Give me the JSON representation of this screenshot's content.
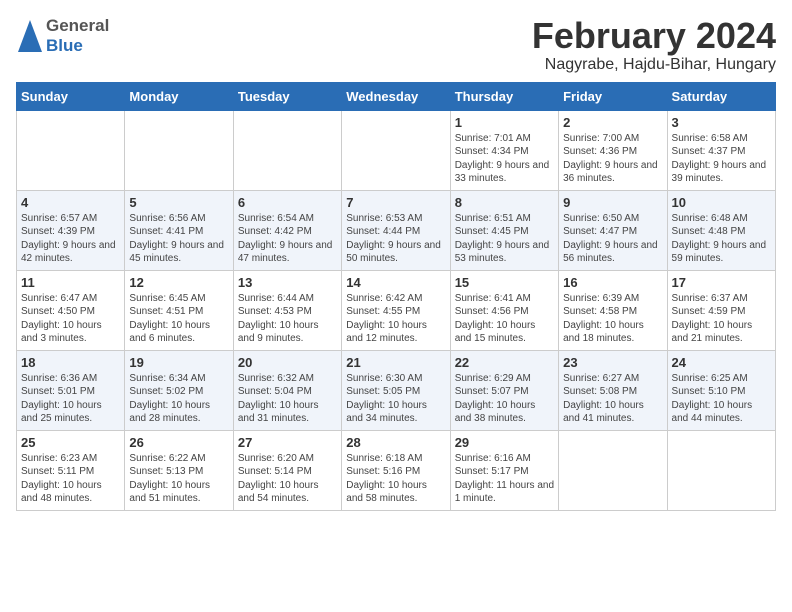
{
  "header": {
    "logo_general": "General",
    "logo_blue": "Blue",
    "title": "February 2024",
    "subtitle": "Nagyrabe, Hajdu-Bihar, Hungary"
  },
  "calendar": {
    "days_of_week": [
      "Sunday",
      "Monday",
      "Tuesday",
      "Wednesday",
      "Thursday",
      "Friday",
      "Saturday"
    ],
    "weeks": [
      [
        {
          "day": "",
          "sunrise": "",
          "sunset": "",
          "daylight": ""
        },
        {
          "day": "",
          "sunrise": "",
          "sunset": "",
          "daylight": ""
        },
        {
          "day": "",
          "sunrise": "",
          "sunset": "",
          "daylight": ""
        },
        {
          "day": "",
          "sunrise": "",
          "sunset": "",
          "daylight": ""
        },
        {
          "day": "1",
          "sunrise": "Sunrise: 7:01 AM",
          "sunset": "Sunset: 4:34 PM",
          "daylight": "Daylight: 9 hours and 33 minutes."
        },
        {
          "day": "2",
          "sunrise": "Sunrise: 7:00 AM",
          "sunset": "Sunset: 4:36 PM",
          "daylight": "Daylight: 9 hours and 36 minutes."
        },
        {
          "day": "3",
          "sunrise": "Sunrise: 6:58 AM",
          "sunset": "Sunset: 4:37 PM",
          "daylight": "Daylight: 9 hours and 39 minutes."
        }
      ],
      [
        {
          "day": "4",
          "sunrise": "Sunrise: 6:57 AM",
          "sunset": "Sunset: 4:39 PM",
          "daylight": "Daylight: 9 hours and 42 minutes."
        },
        {
          "day": "5",
          "sunrise": "Sunrise: 6:56 AM",
          "sunset": "Sunset: 4:41 PM",
          "daylight": "Daylight: 9 hours and 45 minutes."
        },
        {
          "day": "6",
          "sunrise": "Sunrise: 6:54 AM",
          "sunset": "Sunset: 4:42 PM",
          "daylight": "Daylight: 9 hours and 47 minutes."
        },
        {
          "day": "7",
          "sunrise": "Sunrise: 6:53 AM",
          "sunset": "Sunset: 4:44 PM",
          "daylight": "Daylight: 9 hours and 50 minutes."
        },
        {
          "day": "8",
          "sunrise": "Sunrise: 6:51 AM",
          "sunset": "Sunset: 4:45 PM",
          "daylight": "Daylight: 9 hours and 53 minutes."
        },
        {
          "day": "9",
          "sunrise": "Sunrise: 6:50 AM",
          "sunset": "Sunset: 4:47 PM",
          "daylight": "Daylight: 9 hours and 56 minutes."
        },
        {
          "day": "10",
          "sunrise": "Sunrise: 6:48 AM",
          "sunset": "Sunset: 4:48 PM",
          "daylight": "Daylight: 9 hours and 59 minutes."
        }
      ],
      [
        {
          "day": "11",
          "sunrise": "Sunrise: 6:47 AM",
          "sunset": "Sunset: 4:50 PM",
          "daylight": "Daylight: 10 hours and 3 minutes."
        },
        {
          "day": "12",
          "sunrise": "Sunrise: 6:45 AM",
          "sunset": "Sunset: 4:51 PM",
          "daylight": "Daylight: 10 hours and 6 minutes."
        },
        {
          "day": "13",
          "sunrise": "Sunrise: 6:44 AM",
          "sunset": "Sunset: 4:53 PM",
          "daylight": "Daylight: 10 hours and 9 minutes."
        },
        {
          "day": "14",
          "sunrise": "Sunrise: 6:42 AM",
          "sunset": "Sunset: 4:55 PM",
          "daylight": "Daylight: 10 hours and 12 minutes."
        },
        {
          "day": "15",
          "sunrise": "Sunrise: 6:41 AM",
          "sunset": "Sunset: 4:56 PM",
          "daylight": "Daylight: 10 hours and 15 minutes."
        },
        {
          "day": "16",
          "sunrise": "Sunrise: 6:39 AM",
          "sunset": "Sunset: 4:58 PM",
          "daylight": "Daylight: 10 hours and 18 minutes."
        },
        {
          "day": "17",
          "sunrise": "Sunrise: 6:37 AM",
          "sunset": "Sunset: 4:59 PM",
          "daylight": "Daylight: 10 hours and 21 minutes."
        }
      ],
      [
        {
          "day": "18",
          "sunrise": "Sunrise: 6:36 AM",
          "sunset": "Sunset: 5:01 PM",
          "daylight": "Daylight: 10 hours and 25 minutes."
        },
        {
          "day": "19",
          "sunrise": "Sunrise: 6:34 AM",
          "sunset": "Sunset: 5:02 PM",
          "daylight": "Daylight: 10 hours and 28 minutes."
        },
        {
          "day": "20",
          "sunrise": "Sunrise: 6:32 AM",
          "sunset": "Sunset: 5:04 PM",
          "daylight": "Daylight: 10 hours and 31 minutes."
        },
        {
          "day": "21",
          "sunrise": "Sunrise: 6:30 AM",
          "sunset": "Sunset: 5:05 PM",
          "daylight": "Daylight: 10 hours and 34 minutes."
        },
        {
          "day": "22",
          "sunrise": "Sunrise: 6:29 AM",
          "sunset": "Sunset: 5:07 PM",
          "daylight": "Daylight: 10 hours and 38 minutes."
        },
        {
          "day": "23",
          "sunrise": "Sunrise: 6:27 AM",
          "sunset": "Sunset: 5:08 PM",
          "daylight": "Daylight: 10 hours and 41 minutes."
        },
        {
          "day": "24",
          "sunrise": "Sunrise: 6:25 AM",
          "sunset": "Sunset: 5:10 PM",
          "daylight": "Daylight: 10 hours and 44 minutes."
        }
      ],
      [
        {
          "day": "25",
          "sunrise": "Sunrise: 6:23 AM",
          "sunset": "Sunset: 5:11 PM",
          "daylight": "Daylight: 10 hours and 48 minutes."
        },
        {
          "day": "26",
          "sunrise": "Sunrise: 6:22 AM",
          "sunset": "Sunset: 5:13 PM",
          "daylight": "Daylight: 10 hours and 51 minutes."
        },
        {
          "day": "27",
          "sunrise": "Sunrise: 6:20 AM",
          "sunset": "Sunset: 5:14 PM",
          "daylight": "Daylight: 10 hours and 54 minutes."
        },
        {
          "day": "28",
          "sunrise": "Sunrise: 6:18 AM",
          "sunset": "Sunset: 5:16 PM",
          "daylight": "Daylight: 10 hours and 58 minutes."
        },
        {
          "day": "29",
          "sunrise": "Sunrise: 6:16 AM",
          "sunset": "Sunset: 5:17 PM",
          "daylight": "Daylight: 11 hours and 1 minute."
        },
        {
          "day": "",
          "sunrise": "",
          "sunset": "",
          "daylight": ""
        },
        {
          "day": "",
          "sunrise": "",
          "sunset": "",
          "daylight": ""
        }
      ]
    ]
  }
}
